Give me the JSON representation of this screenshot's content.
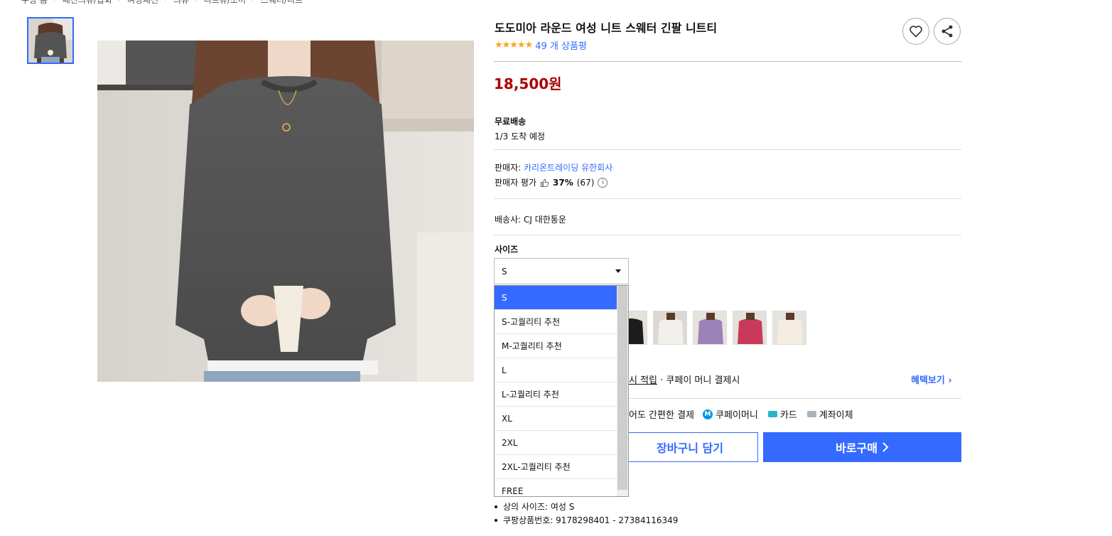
{
  "breadcrumb": [
    "쿠팡 홈",
    "패션의류/잡화",
    "여성패션",
    "의류",
    "니트류/조끼",
    "스웨터/니트"
  ],
  "product": {
    "title": "도도미아 라운드 여성 니트 스웨터 긴팔 니트티",
    "stars": "★★★★★",
    "review_count": "49 개 상품평",
    "price": "18,500원"
  },
  "shipping": {
    "free": "무료배송",
    "arrival": "1/3 도착 예정"
  },
  "seller": {
    "label": "판매자: ",
    "name": "카리온트레이딩 유한회사",
    "rating_label": "판매자 평가",
    "rating_percent": "37%",
    "rating_count": "(67)"
  },
  "carrier": {
    "label": "배송사:  CJ 대한통운"
  },
  "size": {
    "label": "사이즈",
    "selected": "S",
    "options": [
      "S",
      "S-고퀄리티 추천",
      "M-고퀄리티 추천",
      "L",
      "L-고퀄리티 추천",
      "XL",
      "2XL",
      "2XL-고퀄리티 추천",
      "FREE"
    ]
  },
  "benefit": {
    "text_underlined": "시 적립",
    "text_rest": " · 쿠페이 머니 결제시",
    "link": "혜택보기 ›"
  },
  "payment": {
    "text": "어도 간편한 결제",
    "coupay": "쿠페이머니",
    "card": "카드",
    "bank": "계좌이체"
  },
  "buttons": {
    "cart": "장바구니 담기",
    "buy": "바로구매"
  },
  "details": [
    "상의 사이즈: 여성 S",
    "쿠팡상품번호: 9178298401 - 27384116349"
  ],
  "colors": {
    "accent": "#346aff",
    "price": "#ae0000",
    "star": "#f5a623"
  }
}
